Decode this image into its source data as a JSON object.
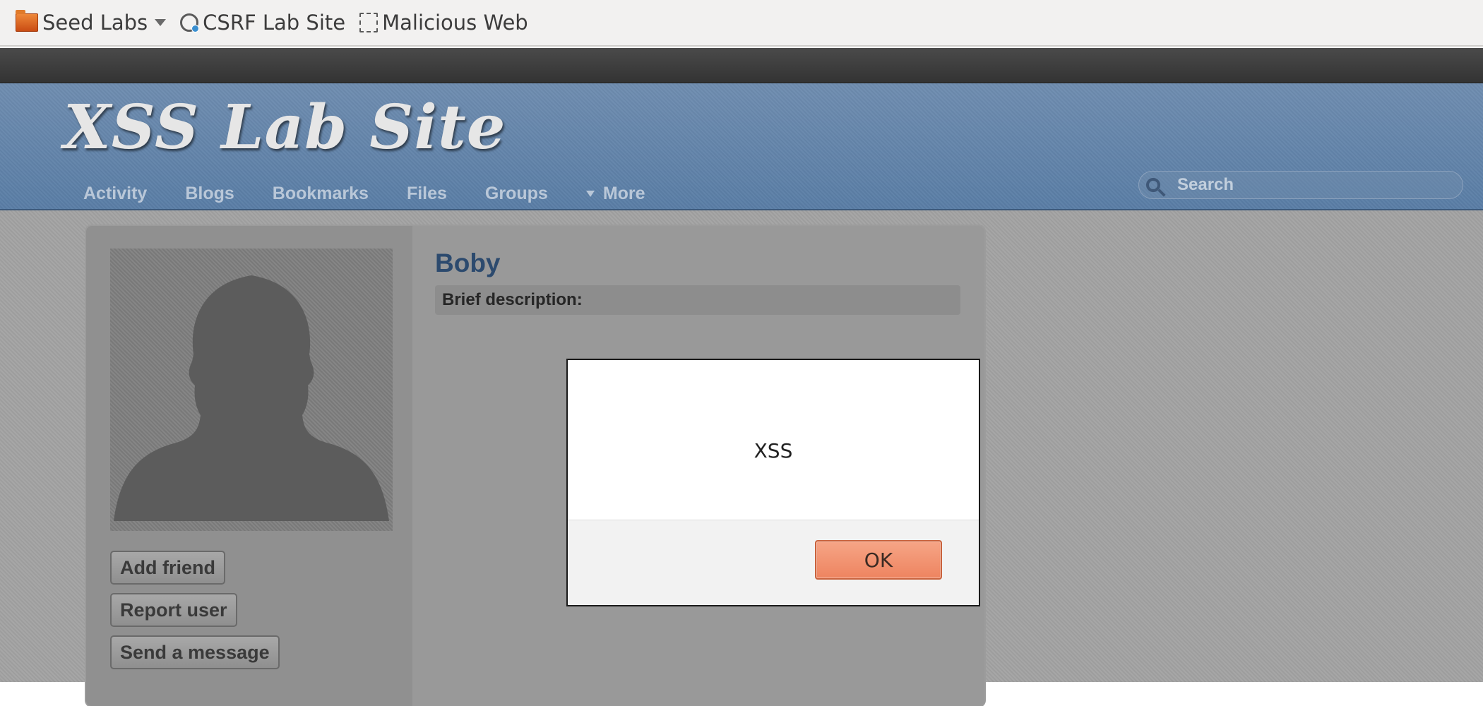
{
  "bookmarks": {
    "items": [
      {
        "label": "Seed Labs",
        "icon": "folder-icon"
      },
      {
        "label": "CSRF Lab Site",
        "icon": "globe-icon"
      },
      {
        "label": "Malicious Web",
        "icon": "page-icon"
      }
    ]
  },
  "header": {
    "site_title": "XSS Lab Site",
    "nav": [
      "Activity",
      "Blogs",
      "Bookmarks",
      "Files",
      "Groups",
      "More"
    ],
    "search_placeholder": "Search"
  },
  "profile": {
    "name": "Boby",
    "brief_label": "Brief description:",
    "actions": [
      "Add friend",
      "Report user",
      "Send a message"
    ]
  },
  "alert": {
    "message": "XSS",
    "ok_label": "OK"
  },
  "colors": {
    "header_blue": "#5a7ea6",
    "ok_button": "#ee8460",
    "name_link": "#2c4a6e"
  }
}
